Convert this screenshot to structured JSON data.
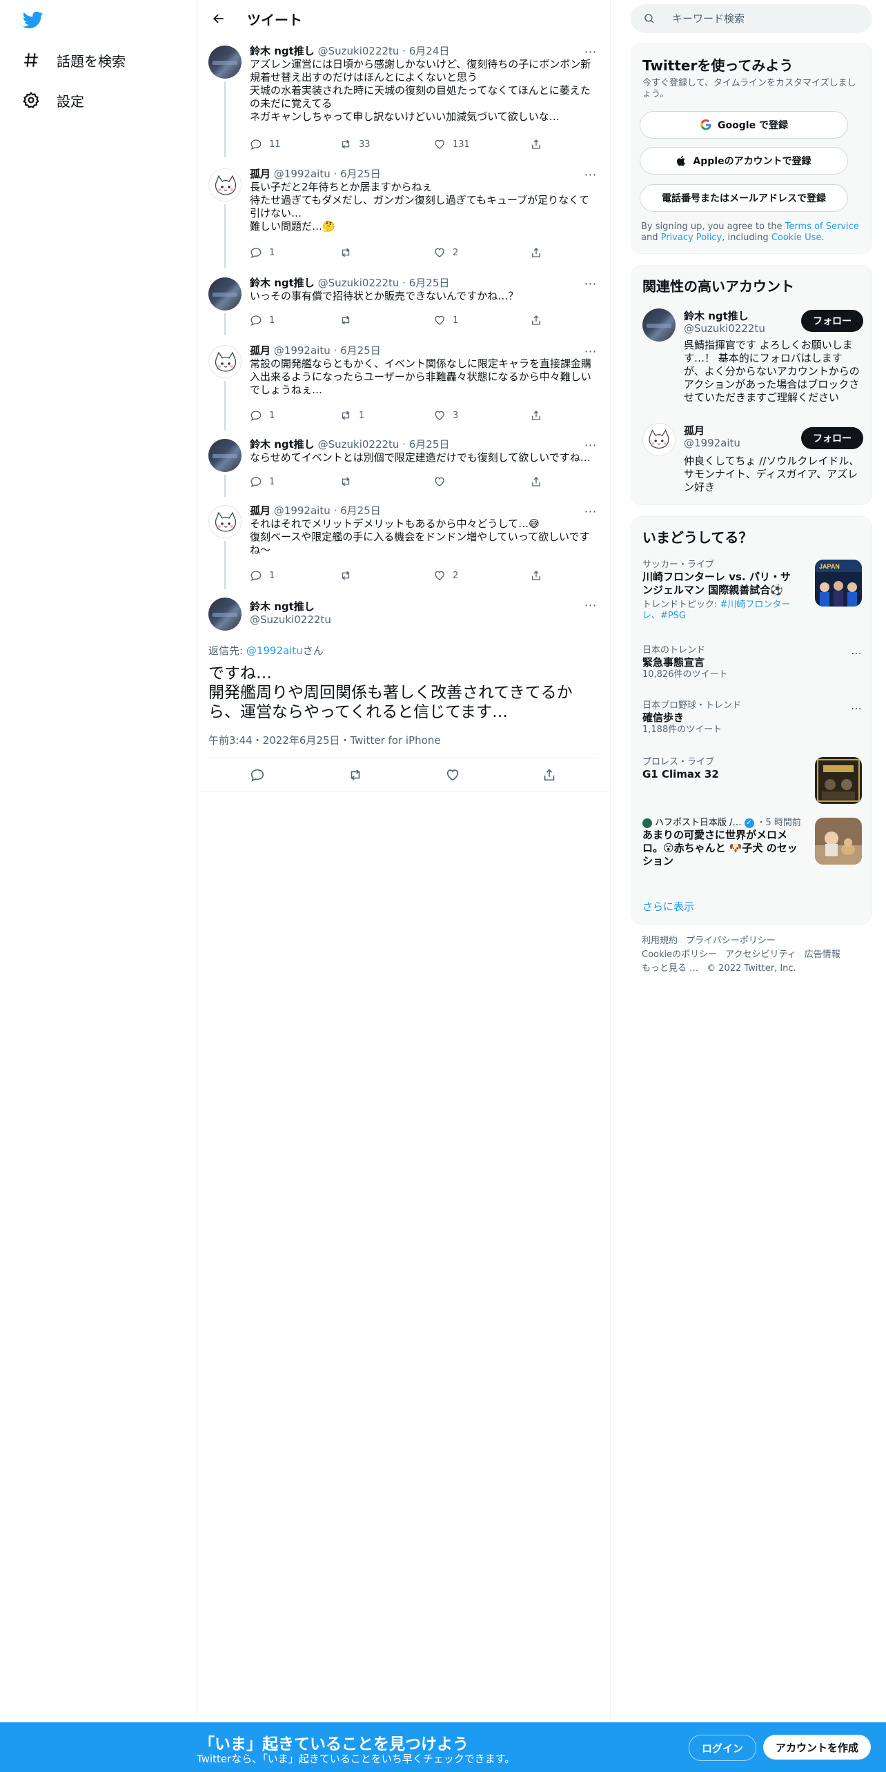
{
  "nav": {
    "explore_label": "話題を検索",
    "settings_label": "設定"
  },
  "header": {
    "title": "ツイート"
  },
  "search": {
    "placeholder": "キーワード検索"
  },
  "tweets": [
    {
      "name": "鈴木 ngt推し",
      "handle": "@Suzuki0222tu",
      "date": "6月24日",
      "text": "アズレン運営には日頃から感謝しかないけど、復刻待ちの子にボンボン新規着せ替え出すのだけはほんとによくないと思う\n天城の水着実装された時に天城の復刻の目処たってなくてほんとに萎えたの未だに覚えてる\nネガキャンしちゃって申し訳ないけどいい加減気づいて欲しいな…",
      "replies": "11",
      "retweets": "33",
      "likes": "131"
    },
    {
      "name": "孤月",
      "handle": "@1992aitu",
      "date": "6月25日",
      "text": "長い子だと2年待ちとか居ますからねぇ\n待たせ過ぎてもダメだし、ガンガン復刻し過ぎてもキューブが足りなくて引けない…\n難しい問題だ…🤔",
      "replies": "1",
      "retweets": "",
      "likes": "2"
    },
    {
      "name": "鈴木 ngt推し",
      "handle": "@Suzuki0222tu",
      "date": "6月25日",
      "text": "いっその事有償で招待状とか販売できないんですかね…？",
      "replies": "1",
      "retweets": "",
      "likes": "1"
    },
    {
      "name": "孤月",
      "handle": "@1992aitu",
      "date": "6月25日",
      "text": "常設の開発艦ならともかく、イベント関係なしに限定キャラを直接課金購入出来るようになったらユーザーから非難轟々状態になるから中々難しいでしょうねぇ…",
      "replies": "1",
      "retweets": "1",
      "likes": "3"
    },
    {
      "name": "鈴木 ngt推し",
      "handle": "@Suzuki0222tu",
      "date": "6月25日",
      "text": "ならせめてイベントとは別個で限定建造だけでも復刻して欲しいですね…",
      "replies": "1",
      "retweets": "",
      "likes": ""
    },
    {
      "name": "孤月",
      "handle": "@1992aitu",
      "date": "6月25日",
      "text": "それはそれでメリットデメリットもあるから中々どうして…😅\n復刻ベースや限定艦の手に入る機会をドンドン増やしていって欲しいですね〜",
      "replies": "1",
      "retweets": "",
      "likes": "2"
    }
  ],
  "focus": {
    "name": "鈴木 ngt推し",
    "handle": "@Suzuki0222tu",
    "reply_prefix": "返信先: ",
    "reply_target": "@1992aitu",
    "reply_suffix": "さん",
    "text": "ですね…\n開発艦周りや周回関係も著しく改善されてきてるから、運営ならやってくれると信じてます…",
    "meta": "午前3:44・2022年6月25日・Twitter for iPhone"
  },
  "signup_card": {
    "title": "Twitterを使ってみよう",
    "subtitle": "今すぐ登録して、タイムラインをカスタマイズしましょう。",
    "google_label": "Google で登録",
    "apple_label": "Appleのアカウントで登録",
    "phone_label": "電話番号またはメールアドレスで登録",
    "terms_prefix": "By signing up, you agree to the ",
    "terms_link": "Terms of Service",
    "terms_and": " and ",
    "privacy_link": "Privacy Policy",
    "terms_including": ", including ",
    "cookie_link": "Cookie Use",
    "terms_end": "."
  },
  "related": {
    "title": "関連性の高いアカウント",
    "follow_label": "フォロー",
    "accounts": [
      {
        "name": "鈴木 ngt推し",
        "handle": "@Suzuki0222tu",
        "bio": "呉鯖指揮官です よろしくお願いします…！ 基本的にフォロバはします が、よく分からないアカウントからのアクションがあった場合はブロックさせていただきますご理解ください"
      },
      {
        "name": "孤月",
        "handle": "@1992aitu",
        "bio": "仲良くしてちょ //ソウルクレイドル、サモンナイト、ディスガイア、アズレン好き"
      }
    ]
  },
  "trends": {
    "title": "いまどうしてる？",
    "items": [
      {
        "meta": "サッカー・ライブ",
        "title": "川崎フロンターレ vs. パリ・サンジェルマン 国際親善試合⚽",
        "sub_prefix": "トレンドトピック: ",
        "sub_links": "#川崎フロンターレ、#PSG"
      },
      {
        "meta": "日本のトレンド",
        "title": "緊急事態宣言",
        "sub": "10,826件のツイート"
      },
      {
        "meta": "日本プロ野球・トレンド",
        "title": "確信歩き",
        "sub": "1,188件のツイート"
      },
      {
        "meta": "プロレス・ライブ",
        "title": "G1 Climax 32"
      },
      {
        "meta": "ハフポスト日本版 /…",
        "time": "・5 時間前",
        "title": "あまりの可愛さに世界がメロメロ。😮赤ちゃんと 🐶子犬 のセッション"
      }
    ],
    "show_more": "さらに表示"
  },
  "footer": {
    "links_row1": [
      "利用規約",
      "プライバシーポリシー"
    ],
    "links_row2": [
      "Cookieのポリシー",
      "アクセシビリティ",
      "広告情報"
    ],
    "more": "もっと見る …",
    "copyright": "© 2022 Twitter, Inc."
  },
  "bottombar": {
    "title": "「いま」起きていることを見つけよう",
    "subtitle": "Twitterなら、「いま」起きていることをいち早くチェックできます。",
    "login_label": "ログイン",
    "signup_label": "アカウントを作成"
  },
  "colors": {
    "accent": "#1d9bf0",
    "text": "#0f1419",
    "secondary": "#536471"
  }
}
